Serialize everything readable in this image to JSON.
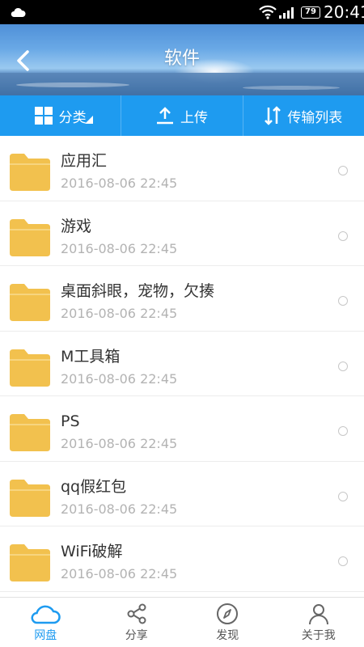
{
  "status_bar": {
    "time": "20:41",
    "battery": "79"
  },
  "header": {
    "title": "软件"
  },
  "toolbar": {
    "category_label": "分类",
    "upload_label": "上传",
    "transfer_label": "传输列表"
  },
  "files": [
    {
      "name": "应用汇",
      "date": "2016-08-06  22:45"
    },
    {
      "name": "游戏",
      "date": "2016-08-06  22:45"
    },
    {
      "name": "桌面斜眼，宠物，欠揍",
      "date": "2016-08-06  22:45"
    },
    {
      "name": "M工具箱",
      "date": "2016-08-06  22:45"
    },
    {
      "name": "PS",
      "date": "2016-08-06  22:45"
    },
    {
      "name": "qq假红包",
      "date": "2016-08-06  22:45"
    },
    {
      "name": "WiFi破解",
      "date": "2016-08-06  22:45"
    }
  ],
  "bottom_nav": [
    {
      "label": "网盘",
      "icon": "cloud-icon",
      "active": true
    },
    {
      "label": "分享",
      "icon": "share-icon",
      "active": false
    },
    {
      "label": "发现",
      "icon": "compass-icon",
      "active": false
    },
    {
      "label": "关于我",
      "icon": "user-icon",
      "active": false
    }
  ],
  "colors": {
    "accent": "#1e9bf0",
    "folder": "#f2c14e",
    "text": "#333333",
    "muted": "#b3b3b3"
  }
}
